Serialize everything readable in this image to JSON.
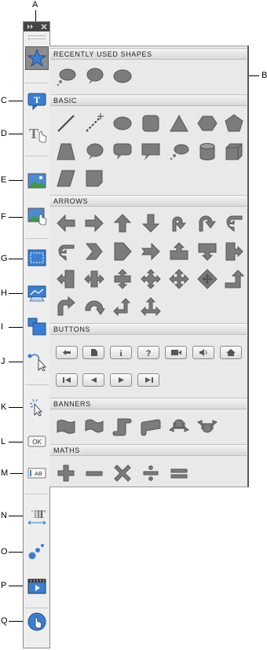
{
  "callouts": {
    "A": "A",
    "B": "B",
    "C": "C",
    "D": "D",
    "E": "E",
    "F": "F",
    "G": "G",
    "H": "H",
    "I": "I",
    "J": "J",
    "K": "K",
    "L": "L",
    "M": "M",
    "N": "N",
    "O": "O",
    "P": "P",
    "Q": "Q"
  },
  "toolbar": {
    "header_icons": [
      "expand-icon",
      "close-icon"
    ],
    "tools": [
      {
        "id": "shapes",
        "icon": "star-icon"
      },
      {
        "id": "text-caption",
        "icon": "text-caption-icon",
        "glyph": "T"
      },
      {
        "id": "rollover-caption",
        "icon": "rollover-text-icon",
        "glyph": "T"
      },
      {
        "id": "image",
        "icon": "image-icon"
      },
      {
        "id": "rollover-image",
        "icon": "rollover-image-icon"
      },
      {
        "id": "highlight-box",
        "icon": "highlight-box-icon"
      },
      {
        "id": "zoom-area",
        "icon": "zoom-area-icon"
      },
      {
        "id": "rollover-slidelet",
        "icon": "slidelet-icon"
      },
      {
        "id": "mouse",
        "icon": "mouse-path-icon"
      },
      {
        "id": "click-box",
        "icon": "click-box-icon"
      },
      {
        "id": "button",
        "icon": "button-icon",
        "text": "OK"
      },
      {
        "id": "text-entry-box",
        "icon": "text-entry-icon",
        "text": "AB"
      },
      {
        "id": "text-animation",
        "icon": "text-animation-icon"
      },
      {
        "id": "animation",
        "icon": "animation-icon"
      },
      {
        "id": "video",
        "icon": "video-icon"
      },
      {
        "id": "interaction",
        "icon": "interaction-icon"
      }
    ]
  },
  "panel": {
    "sections": [
      {
        "title": "RECENTLY USED SHAPES"
      },
      {
        "title": "BASIC"
      },
      {
        "title": "ARROWS"
      },
      {
        "title": "BUTTONS"
      },
      {
        "title": "BANNERS"
      },
      {
        "title": "MATHS"
      }
    ],
    "buttons_text": {
      "info": "i",
      "help": "?"
    }
  },
  "colors": {
    "shape_fill": "#7c7c7c",
    "shape_dark": "#555555",
    "tool_blue": "#3a7fd1",
    "toolbar_bg": "#eeeeee",
    "panel_bg": "#e9e9e9"
  }
}
